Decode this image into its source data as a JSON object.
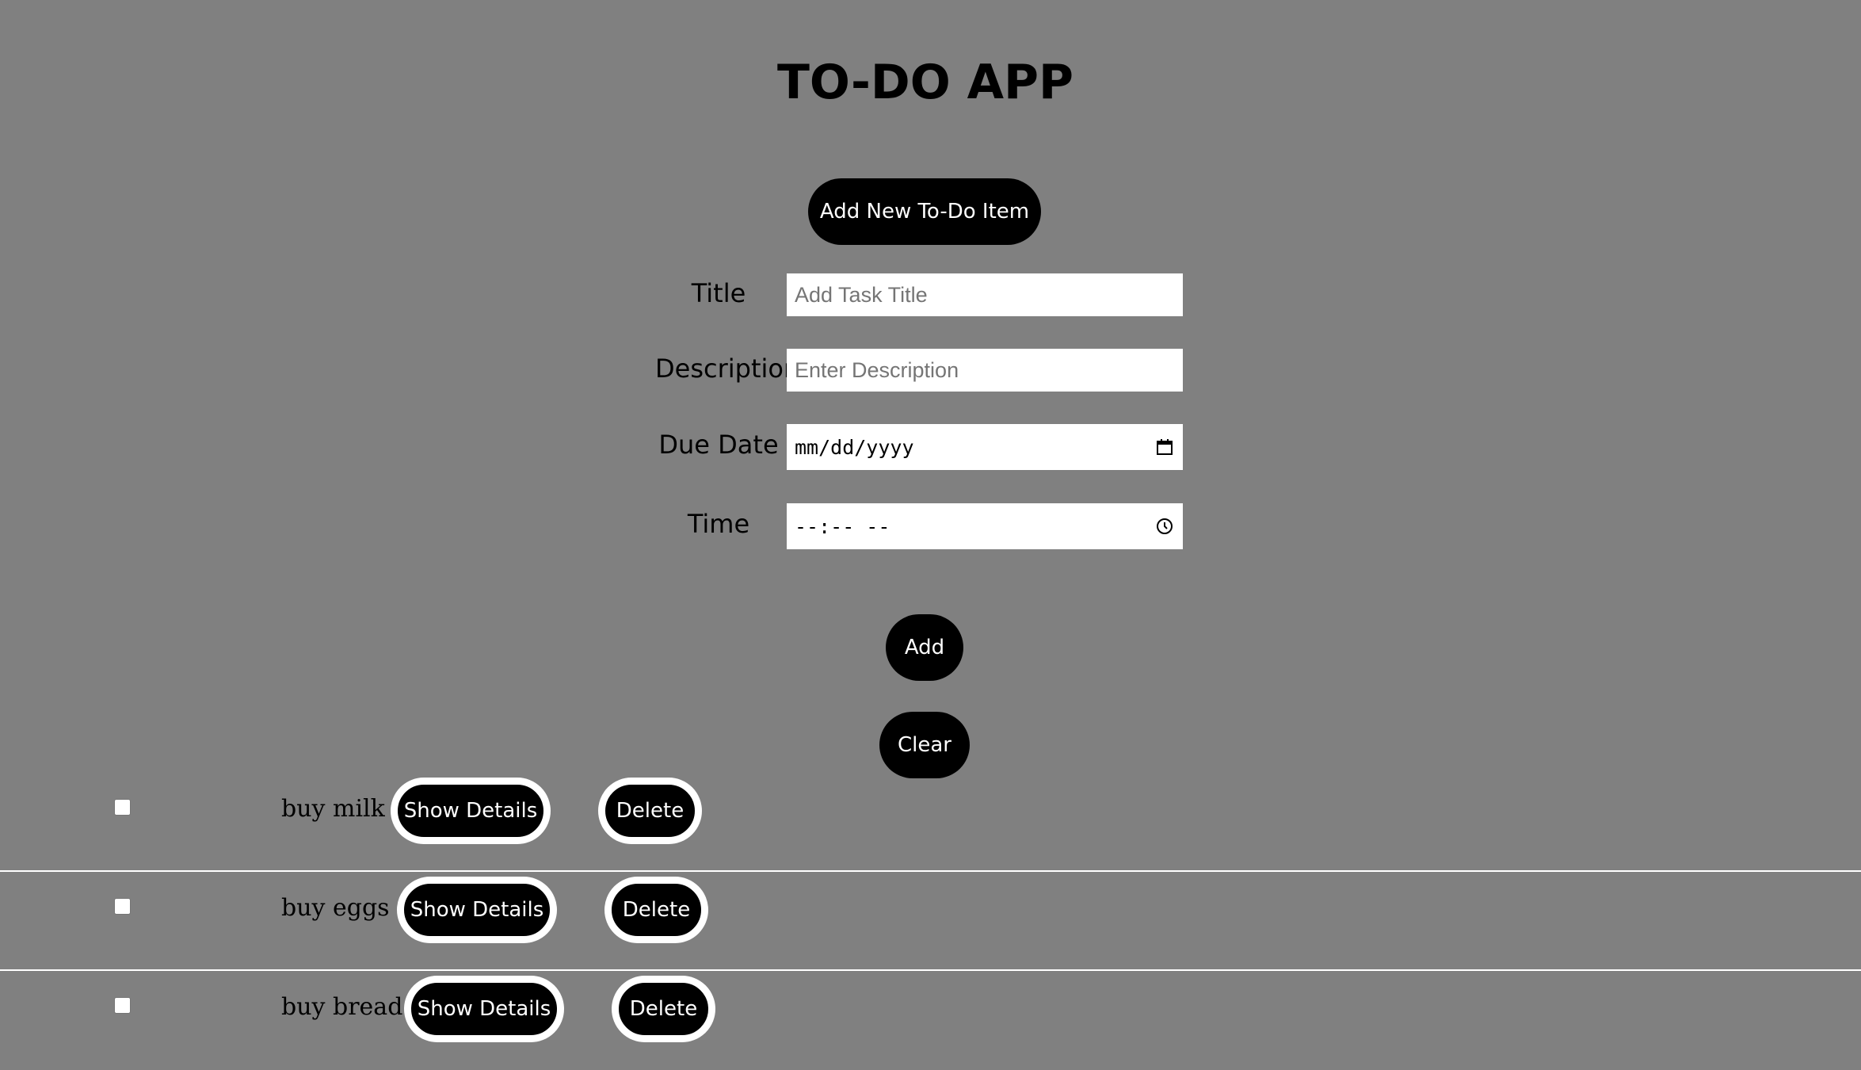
{
  "app": {
    "title": "TO-DO APP"
  },
  "actions": {
    "add_new_label": "Add New To-Do Item",
    "add_label": "Add",
    "clear_label": "Clear"
  },
  "form": {
    "title_label": "Title",
    "title_placeholder": "Add Task Title",
    "description_label": "Description",
    "description_placeholder": "Enter Description",
    "due_date_label": "Due Date",
    "due_date_value": "mm/dd/yyyy",
    "time_label": "Time",
    "time_value": "--:-- --"
  },
  "todos": [
    {
      "text": "buy milk",
      "checked": false,
      "show_details_label": "Show Details",
      "delete_label": "Delete"
    },
    {
      "text": "buy eggs",
      "checked": false,
      "show_details_label": "Show Details",
      "delete_label": "Delete"
    },
    {
      "text": "buy bread",
      "checked": false,
      "show_details_label": "Show Details",
      "delete_label": "Delete"
    }
  ],
  "icons": {
    "date_field": "calendar-icon",
    "time_field": "clock-icon"
  },
  "colors": {
    "background": "#808080",
    "button_bg": "#000000",
    "button_text": "#ffffff",
    "button_ring": "#ffffff",
    "separator": "#ffffff"
  }
}
